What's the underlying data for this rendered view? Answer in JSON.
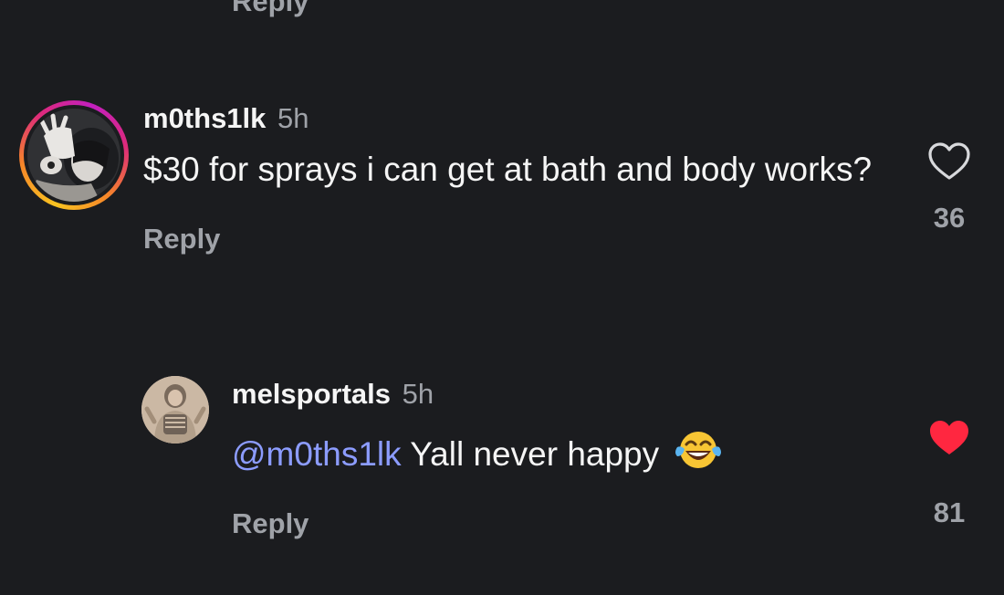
{
  "top_reply": {
    "label": "Reply"
  },
  "comments": [
    {
      "username": "m0ths1lk",
      "time": "5h",
      "text": "$30 for sprays i can get at bath and body works?",
      "reply_label": "Reply",
      "likes": "36",
      "liked": false,
      "avatar_ring": "story-gradient-ring"
    },
    {
      "username": "melsportals",
      "time": "5h",
      "mention": "@m0ths1lk",
      "text": "Yall never happy",
      "emoji": "face-with-tears-of-joy",
      "reply_label": "Reply",
      "likes": "81",
      "liked": true
    }
  ],
  "colors": {
    "background": "#1b1c1f",
    "text": "#f5f5f5",
    "muted": "#9fa2a8",
    "mention": "#8c9cff",
    "like_active": "#ff2740"
  },
  "icons": {
    "like_outline": "heart-outline-icon",
    "like_filled": "heart-filled-icon"
  }
}
